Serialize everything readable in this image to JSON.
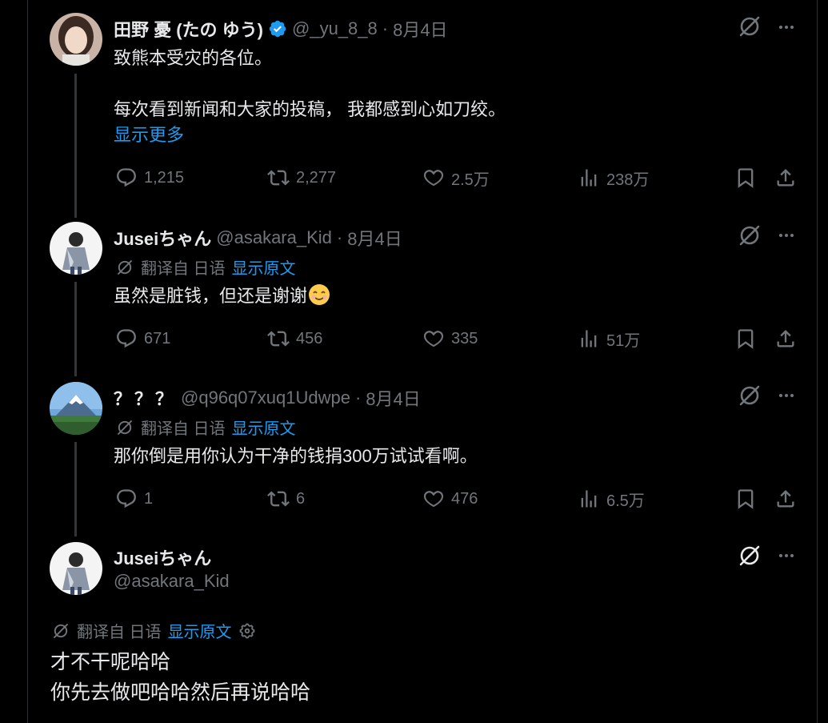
{
  "tweets": [
    {
      "name": "田野 憂 (たの ゆう)",
      "handle": "@_yu_8_8",
      "date": "8月4日",
      "verified": true,
      "lines": [
        "致熊本受灾的各位。",
        "",
        "每次看到新闻和大家的投稿，  我都感到心如刀绞。"
      ],
      "show_more": "显示更多",
      "replies": "1,215",
      "reposts": "2,277",
      "likes": "2.5万",
      "views": "238万"
    },
    {
      "name": "Juseiちゃん",
      "handle": "@asakara_Kid",
      "date": "8月4日",
      "translated_from": "翻译自 日语",
      "show_original": "显示原文",
      "text": "虽然是脏钱，但还是谢谢",
      "replies": "671",
      "reposts": "456",
      "likes": "335",
      "views": "51万"
    },
    {
      "name": "？？？",
      "handle": "@q96q07xuq1Udwpe",
      "date": "8月4日",
      "translated_from": "翻译自 日语",
      "show_original": "显示原文",
      "text": "那你倒是用你认为干净的钱捐300万试试看啊。",
      "replies": "1",
      "reposts": "6",
      "likes": "476",
      "views": "6.5万"
    }
  ],
  "main_tweet": {
    "name": "Juseiちゃん",
    "handle": "@asakara_Kid",
    "translated_from": "翻译自 日语",
    "show_original": "显示原文",
    "lines": [
      "才不干呢哈哈",
      "你先去做吧哈哈然后再说哈哈"
    ]
  },
  "colors": {
    "background": "#000000",
    "text": "#e7e9ea",
    "muted": "#71767b",
    "link": "#1d9bf0"
  }
}
